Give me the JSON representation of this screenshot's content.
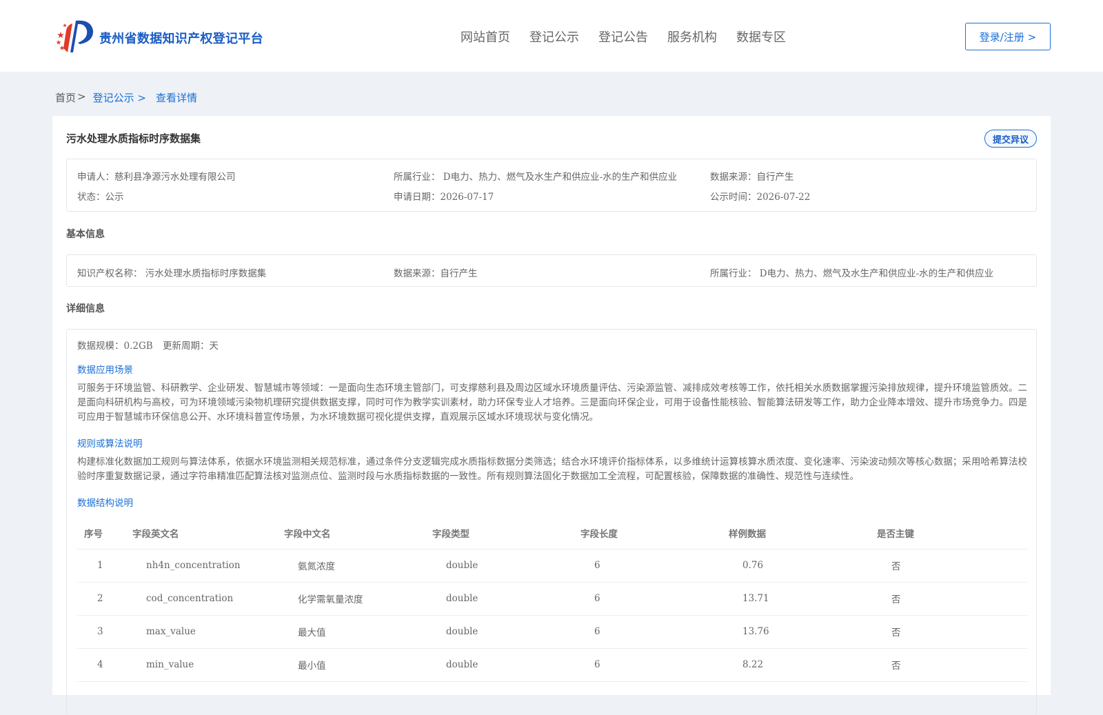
{
  "header": {
    "site_title": "贵州省数据知识产权登记平台",
    "nav": [
      "网站首页",
      "登记公示",
      "登记公告",
      "服务机构",
      "数据专区"
    ],
    "login_label": "登录/注册 >"
  },
  "breadcrumb": {
    "home": "首页",
    "sep": ">",
    "level1": "登记公示 >",
    "current": "查看详情"
  },
  "detail": {
    "title": "污水处理水质指标时序数据集",
    "objection_label": "提交异议",
    "summary": {
      "applicant": "申请人：慈利县净源污水处理有限公司",
      "industry": "所属行业： D电力、热力、燃气及水生产和供应业-水的生产和供应业",
      "source": "数据来源：自行产生",
      "status": "状态：公示",
      "apply_date": "申请日期：2026-07-17",
      "publish_date": "公示时间：2026-07-22"
    },
    "basic": {
      "section_title": "基本信息",
      "ip_name": "知识产权名称： 污水处理水质指标时序数据集",
      "source": "数据来源：自行产生",
      "industry": "所属行业： D电力、热力、燃气及水生产和供应业-水的生产和供应业"
    },
    "details": {
      "section_title": "详细信息",
      "scale": "数据规模：0.2GB",
      "cycle": "更新周期：天",
      "scenario_title": "数据应用场景",
      "scenario_text": "可服务于环境监管、科研教学、企业研发、智慧城市等领域：一是面向生态环境主管部门，可支撑慈利县及周边区域水环境质量评估、污染源监管、减排成效考核等工作，依托相关水质数据掌握污染排放规律，提升环境监管质效。二是面向科研机构与高校，可为环境领域污染物机理研究提供数据支撑，同时可作为教学实训素材，助力环保专业人才培养。三是面向环保企业，可用于设备性能核验、智能算法研发等工作，助力企业降本增效、提升市场竞争力。四是可应用于智慧城市环保信息公开、水环境科普宣传场景，为水环境数据可视化提供支撑，直观展示区域水环境现状与变化情况。",
      "rules_title": "规则或算法说明",
      "rules_text": "构建标准化数据加工规则与算法体系，依据水环境监测相关规范标准，通过条件分支逻辑完成水质指标数据分类筛选；结合水环境评价指标体系，以多维统计运算核算水质浓度、变化速率、污染波动频次等核心数据；采用哈希算法校验时序重复数据记录，通过字符串精准匹配算法核对监测点位、监测时段与水质指标数据的一致性。所有规则算法固化于数据加工全流程，可配置核验，保障数据的准确性、规范性与连续性。",
      "structure_title": "数据结构说明"
    },
    "table": {
      "headers": [
        "序号",
        "字段英文名",
        "字段中文名",
        "字段类型",
        "字段长度",
        "样例数据",
        "是否主键"
      ],
      "rows": [
        [
          "1",
          "nh4n_concentration",
          "氨氮浓度",
          "double",
          "6",
          "0.76",
          "否"
        ],
        [
          "2",
          "cod_concentration",
          "化学需氧量浓度",
          "double",
          "6",
          "13.71",
          "否"
        ],
        [
          "3",
          "max_value",
          "最大值",
          "double",
          "6",
          "13.76",
          "否"
        ],
        [
          "4",
          "min_value",
          "最小值",
          "double",
          "6",
          "8.22",
          "否"
        ]
      ]
    }
  }
}
